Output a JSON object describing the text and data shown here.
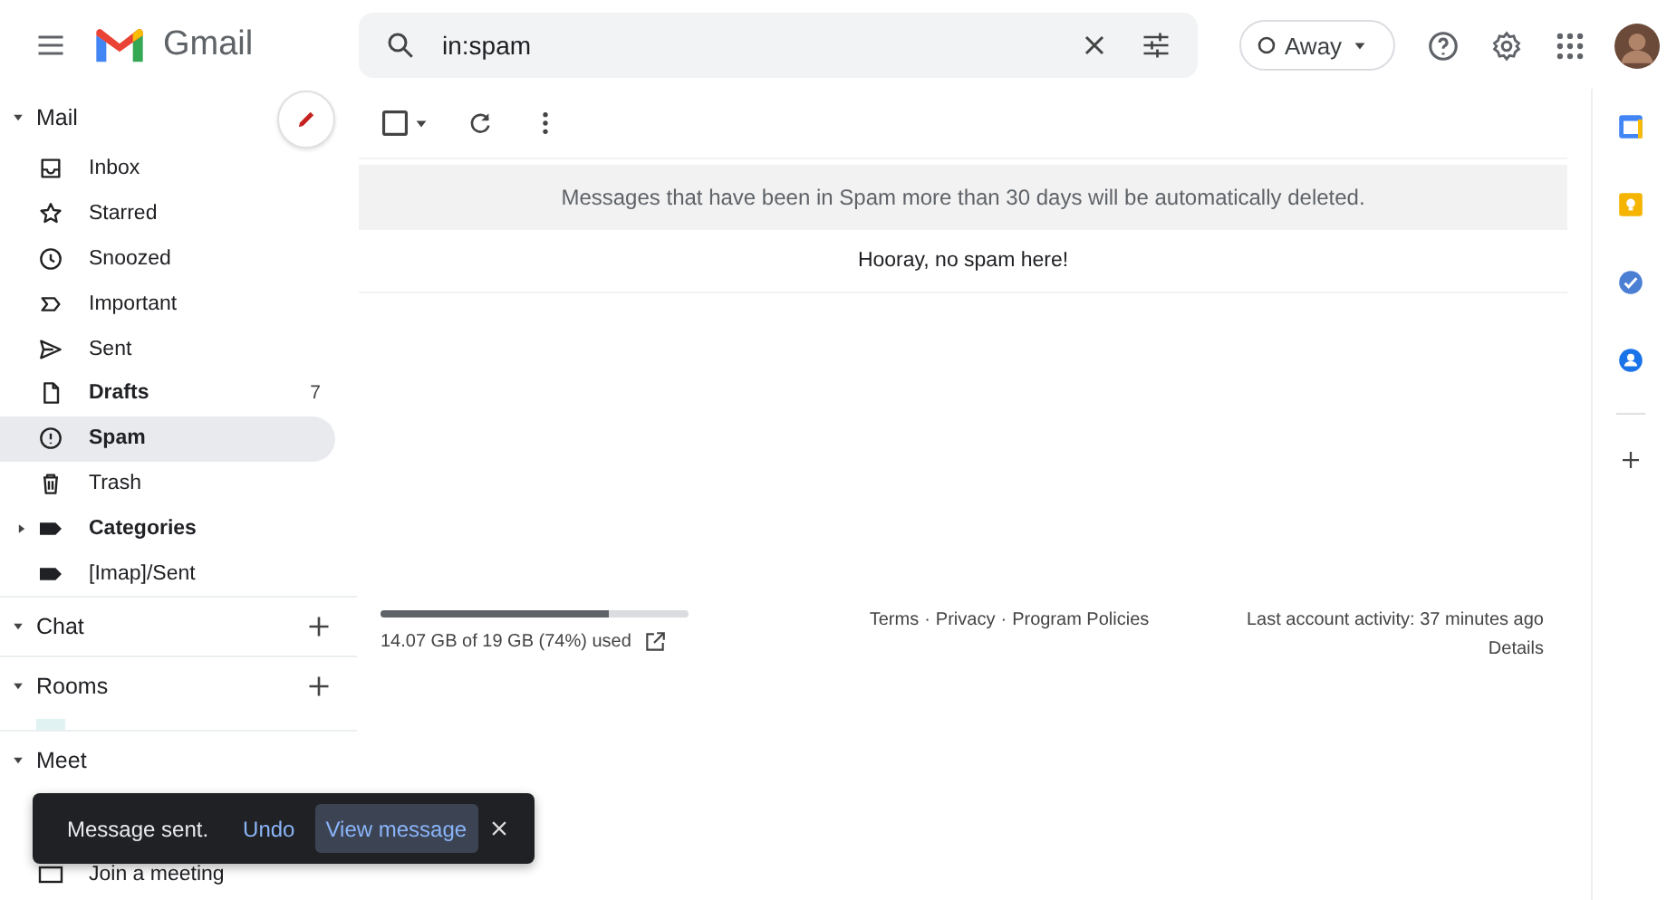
{
  "header": {
    "app_name": "Gmail",
    "search_value": "in:spam",
    "status": "Away"
  },
  "sidebar": {
    "sections": [
      {
        "label": "Mail",
        "expanded": true,
        "add_button": false,
        "compose_button": true
      },
      {
        "label": "Chat",
        "expanded": true,
        "add_button": true,
        "compose_button": false
      },
      {
        "label": "Rooms",
        "expanded": true,
        "add_button": true,
        "compose_button": false
      },
      {
        "label": "Meet",
        "expanded": true,
        "add_button": false,
        "compose_button": false
      }
    ],
    "items": [
      {
        "label": "Inbox",
        "kind": "system",
        "unread": false,
        "selected": false
      },
      {
        "label": "Starred",
        "kind": "system",
        "unread": false,
        "selected": false
      },
      {
        "label": "Snoozed",
        "kind": "system",
        "unread": false,
        "selected": false
      },
      {
        "label": "Important",
        "kind": "system",
        "unread": false,
        "selected": false
      },
      {
        "label": "Sent",
        "kind": "system",
        "unread": false,
        "selected": false
      },
      {
        "label": "Drafts",
        "kind": "system",
        "unread": true,
        "selected": false,
        "count": "7"
      },
      {
        "label": "Spam",
        "kind": "system",
        "unread": false,
        "selected": true
      },
      {
        "label": "Trash",
        "kind": "system",
        "unread": false,
        "selected": false
      },
      {
        "label": "Categories",
        "kind": "group",
        "unread": true,
        "selected": false
      },
      {
        "label": "[Imap]/Sent",
        "kind": "label",
        "unread": false,
        "selected": false
      }
    ],
    "meet_item": "Join a meeting"
  },
  "toolbar": {
    "select_all_checked": false
  },
  "notice": "Messages that have been in Spam more than 30 days will be automatically deleted.",
  "empty_message": "Hooray, no spam here!",
  "footer": {
    "storage_text": "14.07 GB of 19 GB (74%) used",
    "storage": {
      "level": 0.74
    },
    "links": [
      "Terms",
      "Privacy",
      "Program Policies"
    ],
    "separator": "·",
    "activity": "Last account activity: 37 minutes ago",
    "details": "Details"
  },
  "snackbar": {
    "message": "Message sent.",
    "actions": [
      {
        "label": "Undo",
        "focused": false
      },
      {
        "label": "View message",
        "focused": true
      }
    ]
  }
}
